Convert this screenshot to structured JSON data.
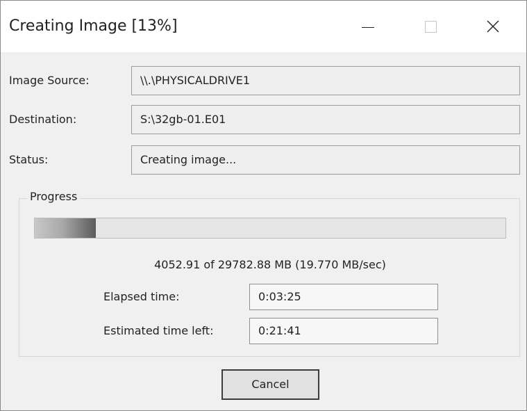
{
  "window": {
    "title": "Creating Image [13%]",
    "controls": {
      "minimize_icon": "minimize-icon",
      "maximize_icon": "maximize-icon",
      "close_icon": "close-icon",
      "close_glyph": "✕"
    }
  },
  "fields": {
    "image_source": {
      "label": "Image Source:",
      "value": "\\\\.\\PHYSICALDRIVE1"
    },
    "destination": {
      "label": "Destination:",
      "value": "S:\\32gb-01.E01"
    },
    "status": {
      "label": "Status:",
      "value": "Creating image..."
    }
  },
  "progress": {
    "group_title": "Progress",
    "fraction": 0.13,
    "summary": "4052.91 of 29782.88 MB (19.770 MB/sec)",
    "elapsed_label": "Elapsed time:",
    "elapsed_value": "0:03:25",
    "remaining_label": "Estimated time left:",
    "remaining_value": "0:21:41"
  },
  "buttons": {
    "cancel_label": "Cancel"
  }
}
